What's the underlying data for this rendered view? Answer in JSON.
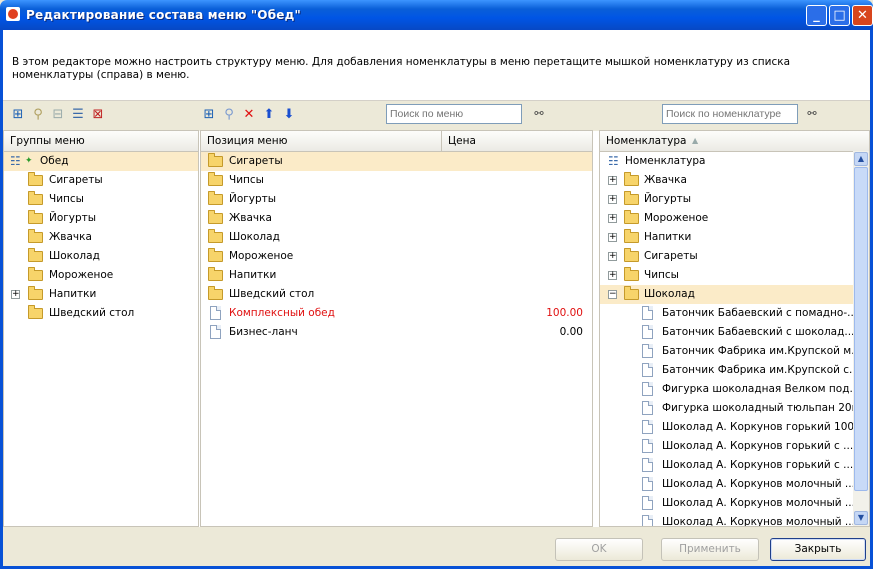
{
  "window": {
    "title": "Редактирование состава меню \"Обед\"",
    "minimize_glyph": "_",
    "maximize_glyph": "□",
    "close_glyph": "✕"
  },
  "description": "В этом редакторе можно настроить структуру меню. Для добавления номенклатуры в меню перетащите мышкой номенклатуру из списка номенклатуры (справа) в меню.",
  "toolbar_left": {
    "icons": [
      "add-group-icon",
      "find-icon",
      "remove-group-icon",
      "properties-icon",
      "delete-icon"
    ]
  },
  "toolbar_middle": {
    "icons": [
      "add-position-icon",
      "find-icon",
      "delete-icon",
      "move-up-icon",
      "move-down-icon"
    ],
    "search_placeholder": "Поиск по меню"
  },
  "toolbar_right": {
    "search_placeholder": "Поиск по номенклатуре"
  },
  "groups": {
    "header": "Группы меню",
    "root": "Обед",
    "items": [
      {
        "label": "Сигареты"
      },
      {
        "label": "Чипсы"
      },
      {
        "label": "Йогурты"
      },
      {
        "label": "Жвачка"
      },
      {
        "label": "Шоколад"
      },
      {
        "label": "Мороженое"
      },
      {
        "label": "Напитки",
        "expandable": true
      },
      {
        "label": "Шведский стол"
      }
    ]
  },
  "positions": {
    "header_name": "Позиция меню",
    "header_price": "Цена",
    "items": [
      {
        "label": "Сигареты",
        "type": "folder",
        "selected": true
      },
      {
        "label": "Чипсы",
        "type": "folder"
      },
      {
        "label": "Йогурты",
        "type": "folder"
      },
      {
        "label": "Жвачка",
        "type": "folder"
      },
      {
        "label": "Шоколад",
        "type": "folder"
      },
      {
        "label": "Мороженое",
        "type": "folder"
      },
      {
        "label": "Напитки",
        "type": "folder"
      },
      {
        "label": "Шведский стол",
        "type": "folder"
      },
      {
        "label": "Комплексный обед",
        "type": "doc",
        "price": "100.00",
        "color": "#e01010"
      },
      {
        "label": "Бизнес-ланч",
        "type": "doc",
        "price": "0.00"
      }
    ]
  },
  "nomenclature": {
    "header": "Номенклатура",
    "sort_indicator": "▲",
    "root": "Номенклатура",
    "folders": [
      {
        "label": "Жвачка"
      },
      {
        "label": "Йогурты"
      },
      {
        "label": "Мороженое"
      },
      {
        "label": "Напитки"
      },
      {
        "label": "Сигареты"
      },
      {
        "label": "Чипсы"
      },
      {
        "label": "Шоколад",
        "expanded": true
      }
    ],
    "items": [
      "Батончик Бабаевский с помадно-...",
      "Батончик Бабаевский с шоколад...",
      "Батончик Фабрика им.Крупской м...",
      "Батончик Фабрика им.Крупской с...",
      "Фигурка шоколадная Велком под...",
      "Фигурка шоколадный тюльпан 20г",
      "Шоколад А. Коркунов горький 100г",
      "Шоколад А. Коркунов горький с ...",
      "Шоколад А. Коркунов горький с ...",
      "Шоколад А. Коркунов молочный ...",
      "Шоколад А. Коркунов молочный ...",
      "Шоколад А. Коркунов молочный ..."
    ]
  },
  "buttons": {
    "ok": "OK",
    "apply": "Применить",
    "close": "Закрыть"
  },
  "colors": {
    "titlebar": "#0055e5",
    "selection": "#fbebc8",
    "accent_red": "#e01010"
  }
}
